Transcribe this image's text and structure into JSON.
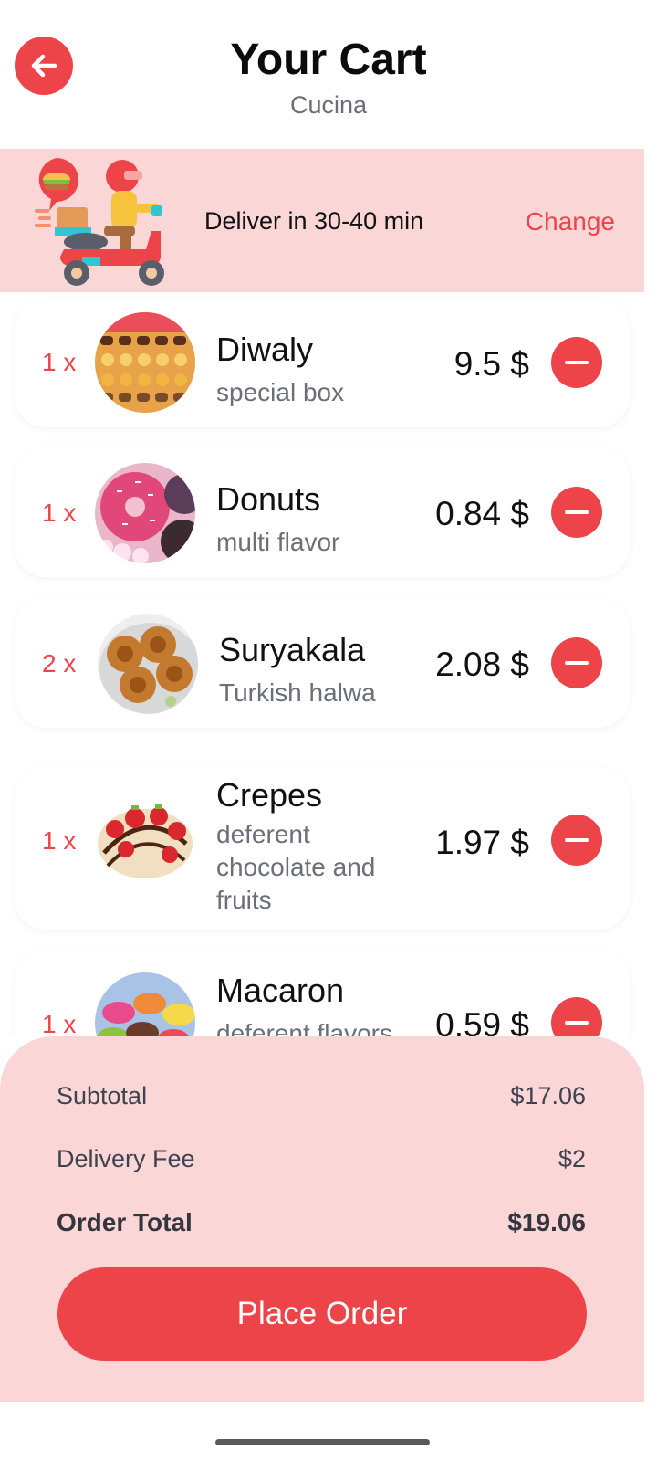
{
  "header": {
    "title": "Your Cart",
    "subtitle": "Cucina"
  },
  "delivery": {
    "text": "Deliver in 30-40 min",
    "change_label": "Change"
  },
  "items": [
    {
      "qty": "1 x",
      "name": "Diwaly",
      "desc": "special box",
      "price": "9.5 $"
    },
    {
      "qty": "1 x",
      "name": "Donuts",
      "desc": "multi flavor",
      "price": "0.84 $"
    },
    {
      "qty": "2 x",
      "name": "Suryakala",
      "desc": "Turkish halwa",
      "price": "2.08 $"
    },
    {
      "qty": "1 x",
      "name": "Crepes",
      "desc": "deferent chocolate and fruits",
      "price": "1.97 $"
    },
    {
      "qty": "1 x",
      "name": "Macaron",
      "desc": "deferent flavors",
      "price": "0.59 $"
    }
  ],
  "summary": {
    "subtotal_label": "Subtotal",
    "subtotal_value": "$17.06",
    "fee_label": "Delivery Fee",
    "fee_value": "$2",
    "total_label": "Order Total",
    "total_value": "$19.06"
  },
  "place_order_label": "Place Order",
  "colors": {
    "accent": "#ec4449",
    "panel": "#fbd6d6"
  }
}
